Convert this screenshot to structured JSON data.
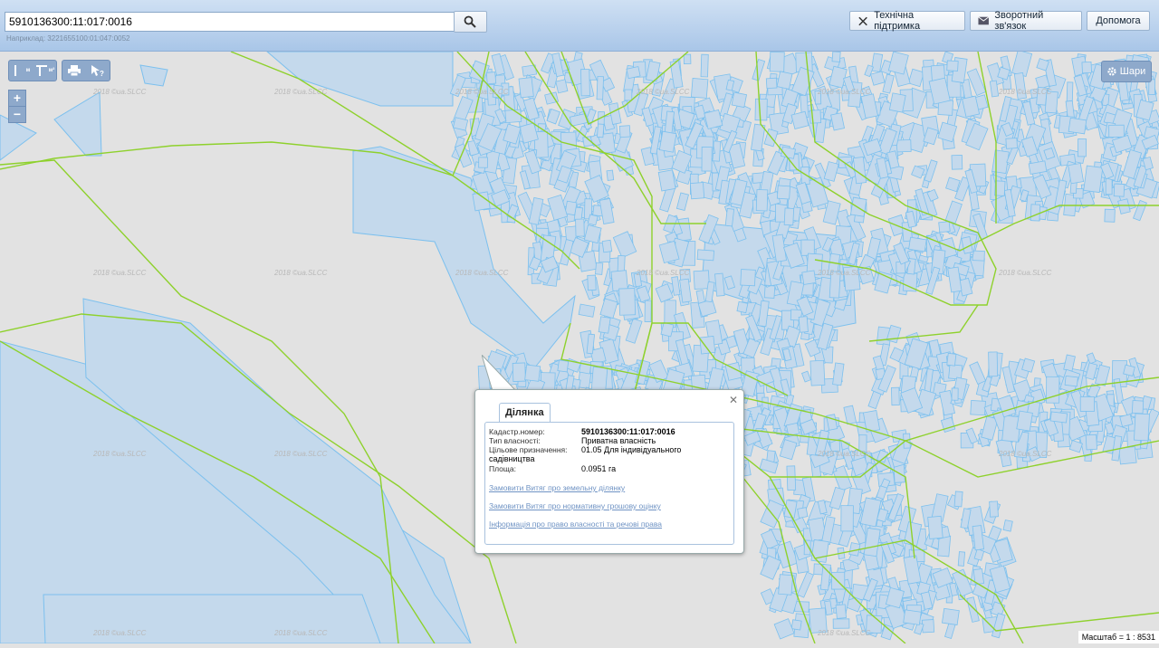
{
  "search": {
    "value": "5910136300:11:017:0016",
    "example": "Наприклад: 3221655100:01:047:0052"
  },
  "header": {
    "support_label": "Технічна підтримка",
    "feedback_label": "Зворотний зв'язок",
    "help_label": "Допомога"
  },
  "toolbar": {
    "measure_m": "м",
    "measure_m2": "м²"
  },
  "layers_label": "Шари",
  "watermark": "2018 ©ua.SLCC",
  "scale_text": "Масштаб = 1 : 8531",
  "popup": {
    "tab_label": "Ділянка",
    "rows": [
      {
        "label": "Кадастр.номер:",
        "value": "5910136300:11:017:0016"
      },
      {
        "label": "Тип власності:",
        "value": "Приватна власність"
      },
      {
        "label": "Цільове призначення:",
        "value": "01.05 Для індивідуального садівництва"
      },
      {
        "label": "Площа:",
        "value": "0.0951 га"
      }
    ],
    "links": [
      "Замовити Витяг про земельну ділянку",
      "Замовити Витяг про нормативну грошову оцінку",
      "Інформація про право власності та речові права"
    ]
  },
  "colors": {
    "parcel_fill": "#c4d9ec",
    "parcel_stroke": "#7cc0ee",
    "boundary": "#8ed12c"
  }
}
